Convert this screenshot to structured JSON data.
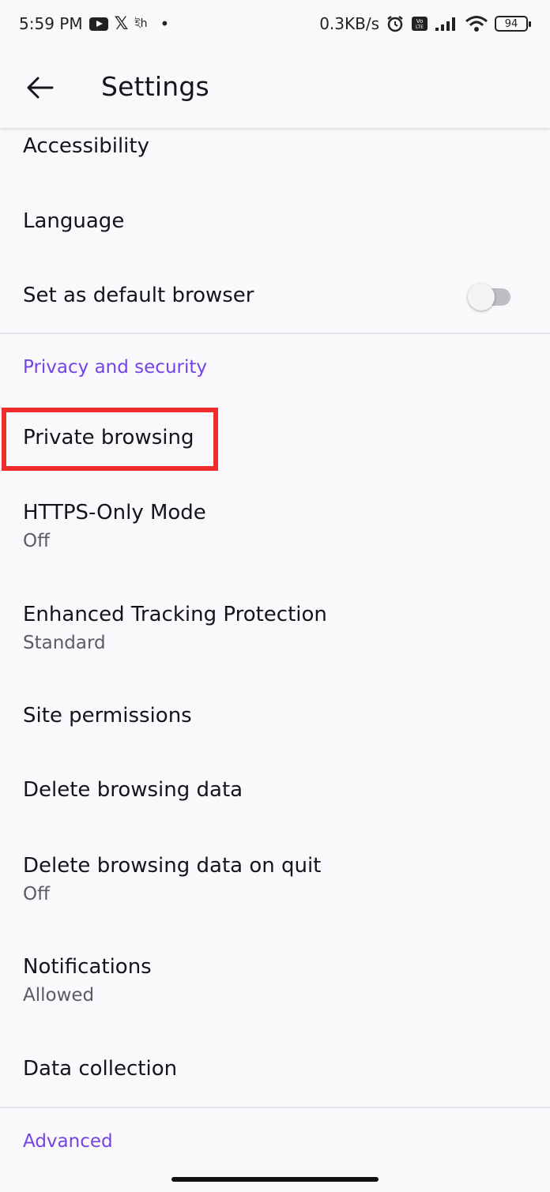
{
  "status_bar": {
    "time": "5:59 PM",
    "extra": "ইh",
    "dot": "•",
    "speed": "0.3KB/s",
    "battery": "94"
  },
  "app_bar": {
    "title": "Settings"
  },
  "settings": {
    "accessibility": "Accessibility",
    "language": "Language",
    "default_browser": "Set as default browser",
    "default_browser_toggle": false,
    "section_privacy": "Privacy and security",
    "private_browsing": "Private browsing",
    "https_only": {
      "title": "HTTPS-Only Mode",
      "summary": "Off"
    },
    "tracking_protection": {
      "title": "Enhanced Tracking Protection",
      "summary": "Standard"
    },
    "site_permissions": "Site permissions",
    "delete_browsing_data": "Delete browsing data",
    "delete_on_quit": {
      "title": "Delete browsing data on quit",
      "summary": "Off"
    },
    "notifications": {
      "title": "Notifications",
      "summary": "Allowed"
    },
    "data_collection": "Data collection",
    "section_advanced": "Advanced"
  },
  "colors": {
    "accent": "#7542e5",
    "highlight": "#ee2d2d"
  }
}
